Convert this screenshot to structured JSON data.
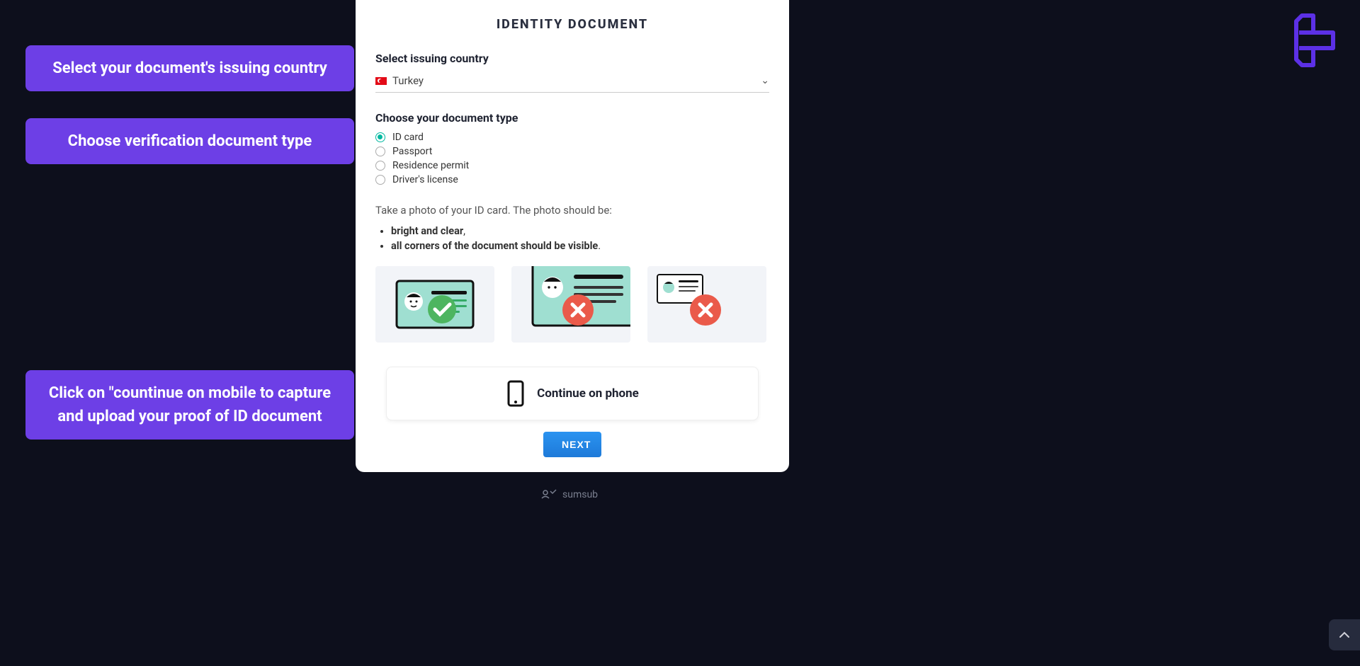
{
  "callouts": {
    "one": "Select your document's issuing country",
    "two": "Choose verification document type",
    "three": "Click on \"countinue on mobile to capture and upload your proof of ID document"
  },
  "card": {
    "title": "IDENTITY DOCUMENT",
    "country_label": "Select issuing country",
    "country_value": "Turkey",
    "doc_type_label": "Choose your document type",
    "doc_types": {
      "id_card": "ID card",
      "passport": "Passport",
      "residence": "Residence permit",
      "drivers": "Driver's license"
    },
    "selected_doc_type": "id_card",
    "instruction": "Take a photo of your ID card. The photo should be:",
    "requirements": {
      "r1_bold": "bright and clear",
      "r1_tail": ",",
      "r2_bold": "all corners of the document should be visible",
      "r2_tail": "."
    },
    "continue_label": "Continue on phone",
    "next_label": "NEXT"
  },
  "footer": {
    "brand": "sumsub"
  }
}
